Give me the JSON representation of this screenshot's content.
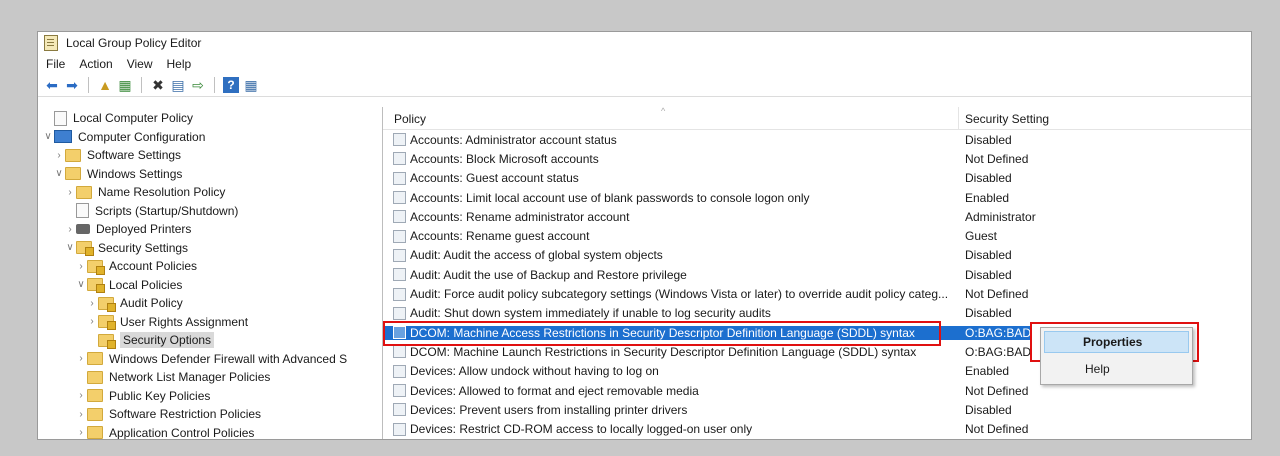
{
  "window": {
    "title": "Local Group Policy Editor"
  },
  "menu": [
    "File",
    "Action",
    "View",
    "Help"
  ],
  "toolbar": [
    "back-arrow-icon",
    "forward-arrow-icon",
    "|",
    "up-folder-icon",
    "show-hide-tree-icon",
    "|",
    "delete-icon",
    "properties-icon",
    "export-list-icon",
    "|",
    "help-icon",
    "view-icon"
  ],
  "tree": [
    {
      "label": "Local Computer Policy",
      "icon": "policy-doc-icon",
      "level": 0,
      "chev": ""
    },
    {
      "label": "Computer Configuration",
      "icon": "computer-icon",
      "level": 0,
      "chev": "v"
    },
    {
      "label": "Software Settings",
      "icon": "folder-icon",
      "level": 1,
      "chev": ">"
    },
    {
      "label": "Windows Settings",
      "icon": "folder-icon",
      "level": 1,
      "chev": "v"
    },
    {
      "label": "Name Resolution Policy",
      "icon": "folder-icon",
      "level": 2,
      "chev": ">"
    },
    {
      "label": "Scripts (Startup/Shutdown)",
      "icon": "script-icon",
      "level": 2,
      "chev": ""
    },
    {
      "label": "Deployed Printers",
      "icon": "printer-icon",
      "level": 2,
      "chev": ">"
    },
    {
      "label": "Security Settings",
      "icon": "security-folder-icon",
      "level": 2,
      "chev": "v"
    },
    {
      "label": "Account Policies",
      "icon": "security-folder-icon",
      "level": 3,
      "chev": ">"
    },
    {
      "label": "Local Policies",
      "icon": "security-folder-icon",
      "level": 3,
      "chev": "v"
    },
    {
      "label": "Audit Policy",
      "icon": "security-folder-icon",
      "level": 4,
      "chev": ">"
    },
    {
      "label": "User Rights Assignment",
      "icon": "security-folder-icon",
      "level": 4,
      "chev": ">"
    },
    {
      "label": "Security Options",
      "icon": "security-folder-icon",
      "level": 4,
      "chev": "",
      "selected": true
    },
    {
      "label": "Windows Defender Firewall with Advanced S",
      "icon": "folder-icon",
      "level": 3,
      "chev": ">"
    },
    {
      "label": "Network List Manager Policies",
      "icon": "folder-icon",
      "level": 3,
      "chev": ""
    },
    {
      "label": "Public Key Policies",
      "icon": "folder-icon",
      "level": 3,
      "chev": ">"
    },
    {
      "label": "Software Restriction Policies",
      "icon": "folder-icon",
      "level": 3,
      "chev": ">"
    },
    {
      "label": "Application Control Policies",
      "icon": "folder-icon",
      "level": 3,
      "chev": ">"
    }
  ],
  "list": {
    "columns": {
      "policy": "Policy",
      "setting": "Security Setting"
    },
    "rows": [
      {
        "policy": "Accounts: Administrator account status",
        "setting": "Disabled"
      },
      {
        "policy": "Accounts: Block Microsoft accounts",
        "setting": "Not Defined"
      },
      {
        "policy": "Accounts: Guest account status",
        "setting": "Disabled"
      },
      {
        "policy": "Accounts: Limit local account use of blank passwords to console logon only",
        "setting": "Enabled"
      },
      {
        "policy": "Accounts: Rename administrator account",
        "setting": "Administrator"
      },
      {
        "policy": "Accounts: Rename guest account",
        "setting": "Guest"
      },
      {
        "policy": "Audit: Audit the access of global system objects",
        "setting": "Disabled"
      },
      {
        "policy": "Audit: Audit the use of Backup and Restore privilege",
        "setting": "Disabled"
      },
      {
        "policy": "Audit: Force audit policy subcategory settings (Windows Vista or later) to override audit policy categ...",
        "setting": "Not Defined"
      },
      {
        "policy": "Audit: Shut down system immediately if unable to log security audits",
        "setting": "Disabled"
      },
      {
        "policy": "DCOM: Machine Access Restrictions in Security Descriptor Definition Language (SDDL) syntax",
        "setting": "O:BAG:BAD",
        "highlighted": true
      },
      {
        "policy": "DCOM: Machine Launch Restrictions in Security Descriptor Definition Language (SDDL) syntax",
        "setting": "O:BAG:BAD"
      },
      {
        "policy": "Devices: Allow undock without having to log on",
        "setting": "Enabled"
      },
      {
        "policy": "Devices: Allowed to format and eject removable media",
        "setting": "Not Defined"
      },
      {
        "policy": "Devices: Prevent users from installing printer drivers",
        "setting": "Disabled"
      },
      {
        "policy": "Devices: Restrict CD-ROM access to locally logged-on user only",
        "setting": "Not Defined"
      }
    ]
  },
  "context_menu": {
    "properties": "Properties",
    "help": "Help"
  },
  "colors": {
    "selection": "#1c6fcf",
    "highlight_box": "#e01010",
    "menu_hover": "#cce4f7"
  }
}
